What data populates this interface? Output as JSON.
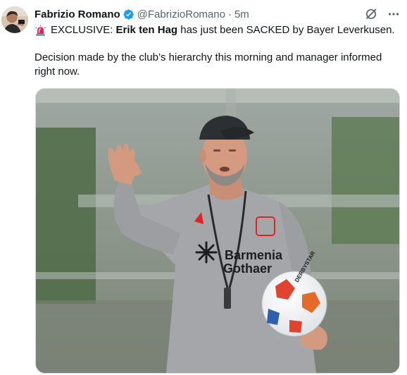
{
  "author": {
    "name": "Fabrizio Romano",
    "handle": "@FabrizioRomano",
    "separator": "·",
    "time": "5m"
  },
  "tweet": {
    "prefix": "EXCLUSIVE:",
    "name_bold": "Erik ten Hag",
    "headline_rest": "has just been SACKED by Bayer Leverkusen.",
    "body": "Decision made by the club’s hierarchy this morning and manager informed right now."
  },
  "media": {
    "shirt_brand_line1": "Barmenia",
    "shirt_brand_line2": "Gothaer",
    "ball_text": "DERBYSTAR"
  },
  "icons": {
    "siren": "rotating-light-icon",
    "verified": "verified-badge-icon",
    "grok": "grok-icon",
    "more": "more-icon"
  },
  "colors": {
    "verified_blue": "#1d9bf0",
    "secondary_text": "#536471",
    "siren_red": "#e0245e"
  }
}
